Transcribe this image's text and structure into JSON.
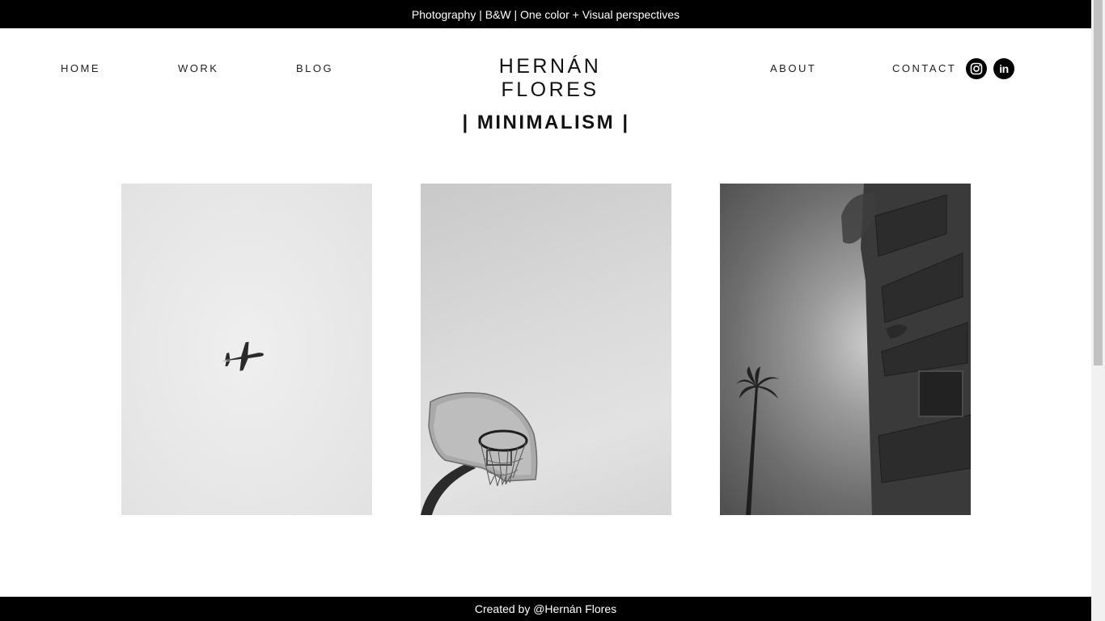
{
  "banner": {
    "text": "Photography | B&W | One color + Visual perspectives"
  },
  "nav": {
    "home": "HOME",
    "work": "WORK",
    "blog": "BLOG",
    "about": "ABOUT",
    "contact": "CONTACT"
  },
  "brand": {
    "name": "HERNÁN FLORES"
  },
  "social": [
    {
      "icon": "instagram-icon"
    },
    {
      "icon": "linkedin-icon",
      "glyph": "in"
    }
  ],
  "section": {
    "title": "| MINIMALISM |"
  },
  "gallery": [
    {
      "subject": "airplane",
      "tone": "light"
    },
    {
      "subject": "basketball-hoop",
      "tone": "light"
    },
    {
      "subject": "palm-tree-building",
      "tone": "dark"
    }
  ],
  "footer": {
    "text": "Created by @Hernán Flores"
  },
  "colors": {
    "bar": "#000000",
    "background": "#ffffff",
    "text": "#111111"
  }
}
